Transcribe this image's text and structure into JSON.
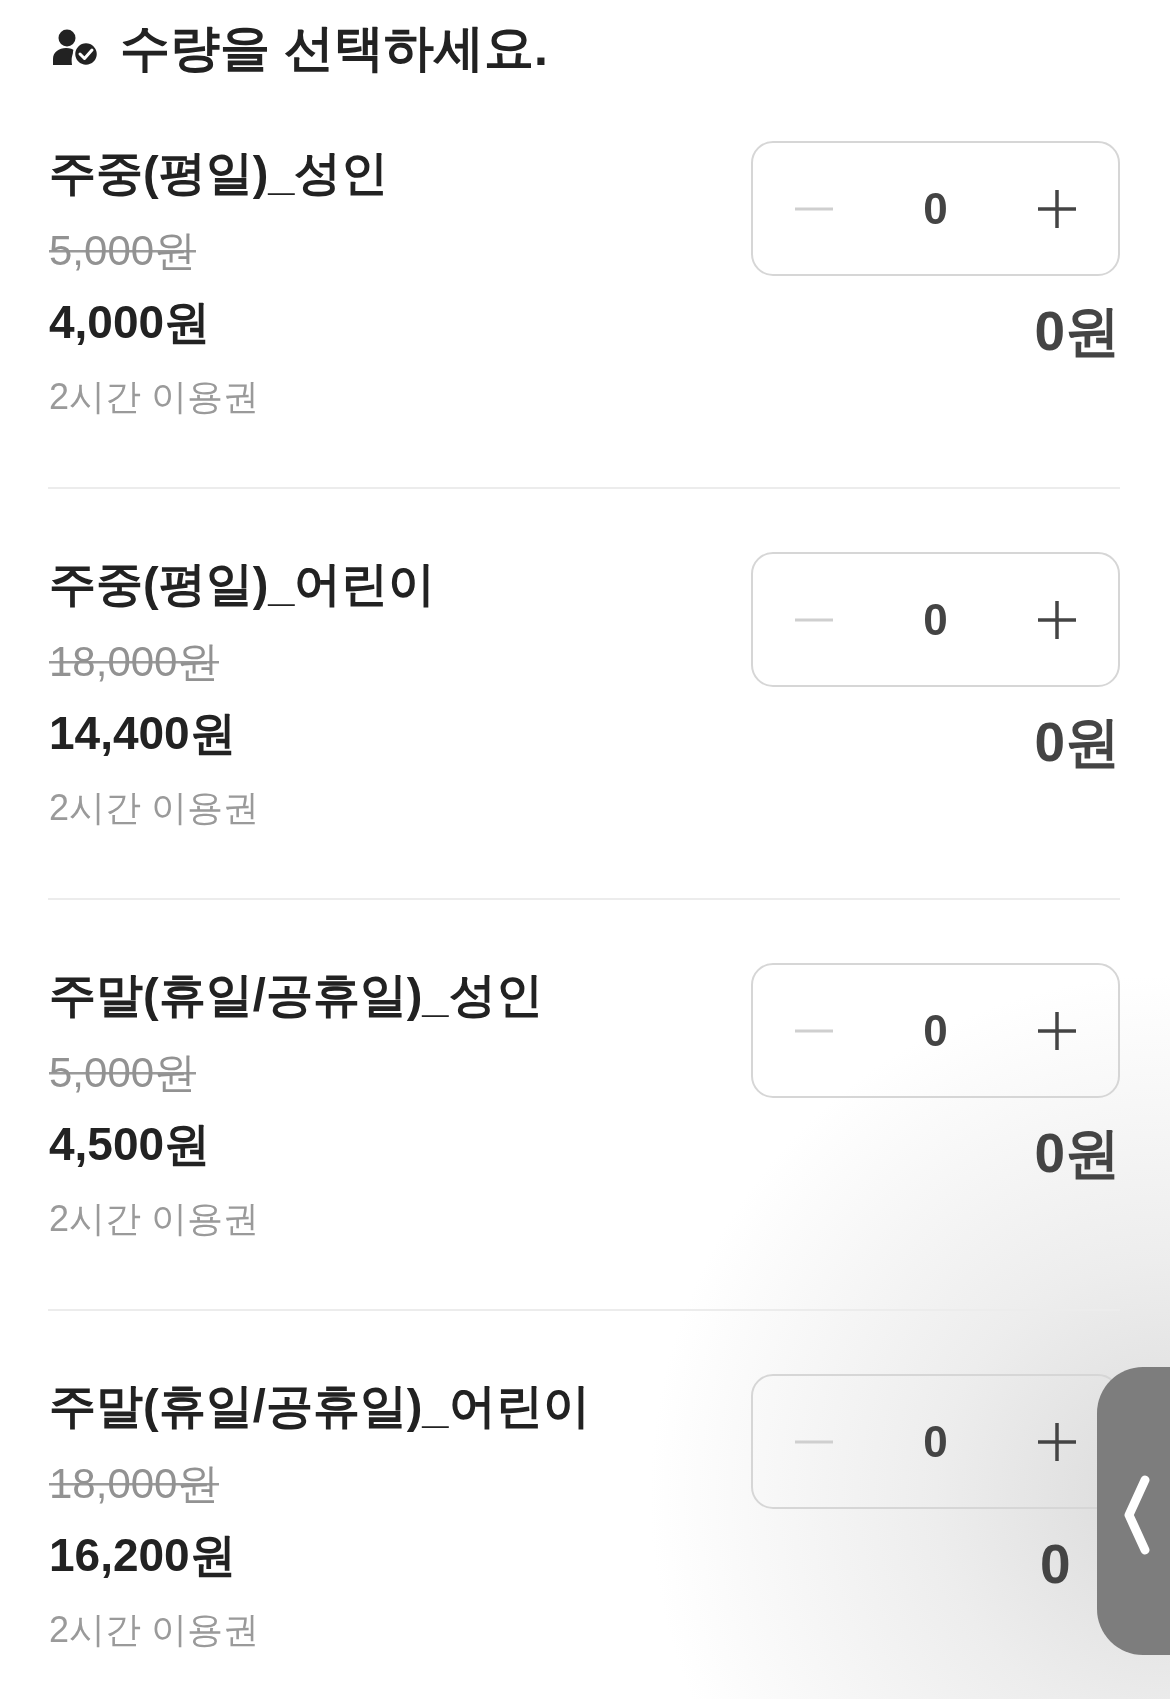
{
  "header": {
    "title": "수량을 선택하세요."
  },
  "items": [
    {
      "name": "주중(평일)_성인",
      "original_price": "5,000원",
      "price": "4,000원",
      "note": "2시간 이용권",
      "quantity": "0",
      "decrease_disabled": true,
      "subtotal": "0원"
    },
    {
      "name": "주중(평일)_어린이",
      "original_price": "18,000원",
      "price": "14,400원",
      "note": "2시간 이용권",
      "quantity": "0",
      "decrease_disabled": true,
      "subtotal": "0원"
    },
    {
      "name": "주말(휴일/공휴일)_성인",
      "original_price": "5,000원",
      "price": "4,500원",
      "note": "2시간 이용권",
      "quantity": "0",
      "decrease_disabled": true,
      "subtotal": "0원"
    },
    {
      "name": "주말(휴일/공휴일)_어린이",
      "original_price": "18,000원",
      "price": "16,200원",
      "note": "2시간 이용권",
      "quantity": "0",
      "decrease_disabled": true,
      "subtotal": "0"
    }
  ]
}
